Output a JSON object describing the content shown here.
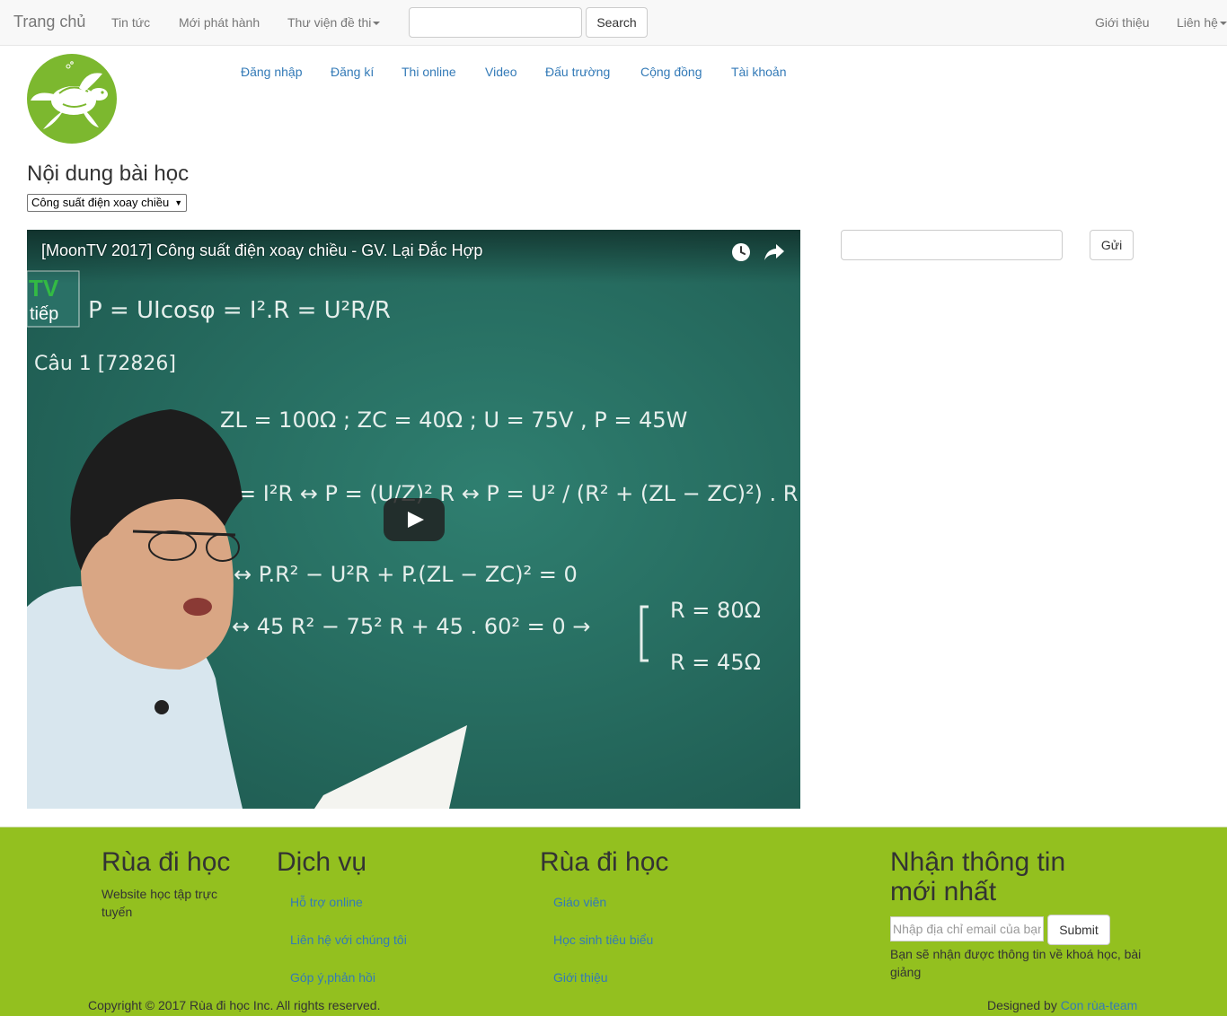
{
  "topnav": {
    "brand": "Trang chủ",
    "items": [
      {
        "label": "Tin tức"
      },
      {
        "label": "Mới phát hành"
      },
      {
        "label": "Thư viện đề thi"
      }
    ],
    "search_button": "Search",
    "right_items": [
      {
        "label": "Giới thiệu"
      },
      {
        "label": "Liên hệ"
      }
    ]
  },
  "logo": {
    "icon": "turtle-logo-icon",
    "color": "#7cb82f"
  },
  "subnav": [
    {
      "label": "Đăng nhập"
    },
    {
      "label": "Đăng kí"
    },
    {
      "label": "Thi online"
    },
    {
      "label": "Video"
    },
    {
      "label": "Đấu trường"
    },
    {
      "label": "Cộng đồng"
    },
    {
      "label": "Tài khoản"
    }
  ],
  "lesson": {
    "title": "Nội dung bài học",
    "selected": "Công suất điện xoay chiều"
  },
  "video": {
    "title": "[MoonTV 2017] Công suất điện xoay chiều - GV. Lại Đắc Hợp",
    "play_icon": "play-icon",
    "board": {
      "badge_top": "TV",
      "badge_bottom": "tiếp",
      "line1": "P = UIcosφ = I².R = U²R/R",
      "line2": "Câu 1 [72826]",
      "line3": "ZL = 100Ω ; ZC = 40Ω ; U = 75V , P = 45W",
      "line4": "= I²R ↔ P = (U/Z)² R ↔ P = U² / (R² + (ZL − ZC)²) . R",
      "line5": "↔ P.R² − U²R + P.(ZL − ZC)² = 0",
      "line6": "↔ 45 R² − 75² R + 45 . 60² = 0 →",
      "line7": "R = 80Ω",
      "line8": "R = 45Ω"
    }
  },
  "comment": {
    "send_button": "Gửi"
  },
  "footer": {
    "bg_color": "#93c01f",
    "col1": {
      "heading": "Rùa đi học",
      "text": "Website học tập trực tuyến"
    },
    "col2": {
      "heading": "Dịch vụ",
      "links": [
        "Hỗ trợ online",
        "Liên hệ với chúng tôi",
        "Góp ý,phản hồi"
      ]
    },
    "col3": {
      "heading": "Rùa đi học",
      "links": [
        "Giáo viên",
        "Học sinh tiêu biểu",
        "Giới thiệu"
      ]
    },
    "col4": {
      "heading": "Nhận thông tin mới nhất",
      "email_placeholder": "Nhập địa chỉ email của bạn",
      "submit": "Submit",
      "note": "Bạn sẽ nhận được thông tin về khoá học, bài giảng"
    },
    "copyright": "Copyright © 2017 Rùa đi học Inc. All rights reserved.",
    "designed_by": "Designed by",
    "designer_link": "Con rùa-team"
  }
}
